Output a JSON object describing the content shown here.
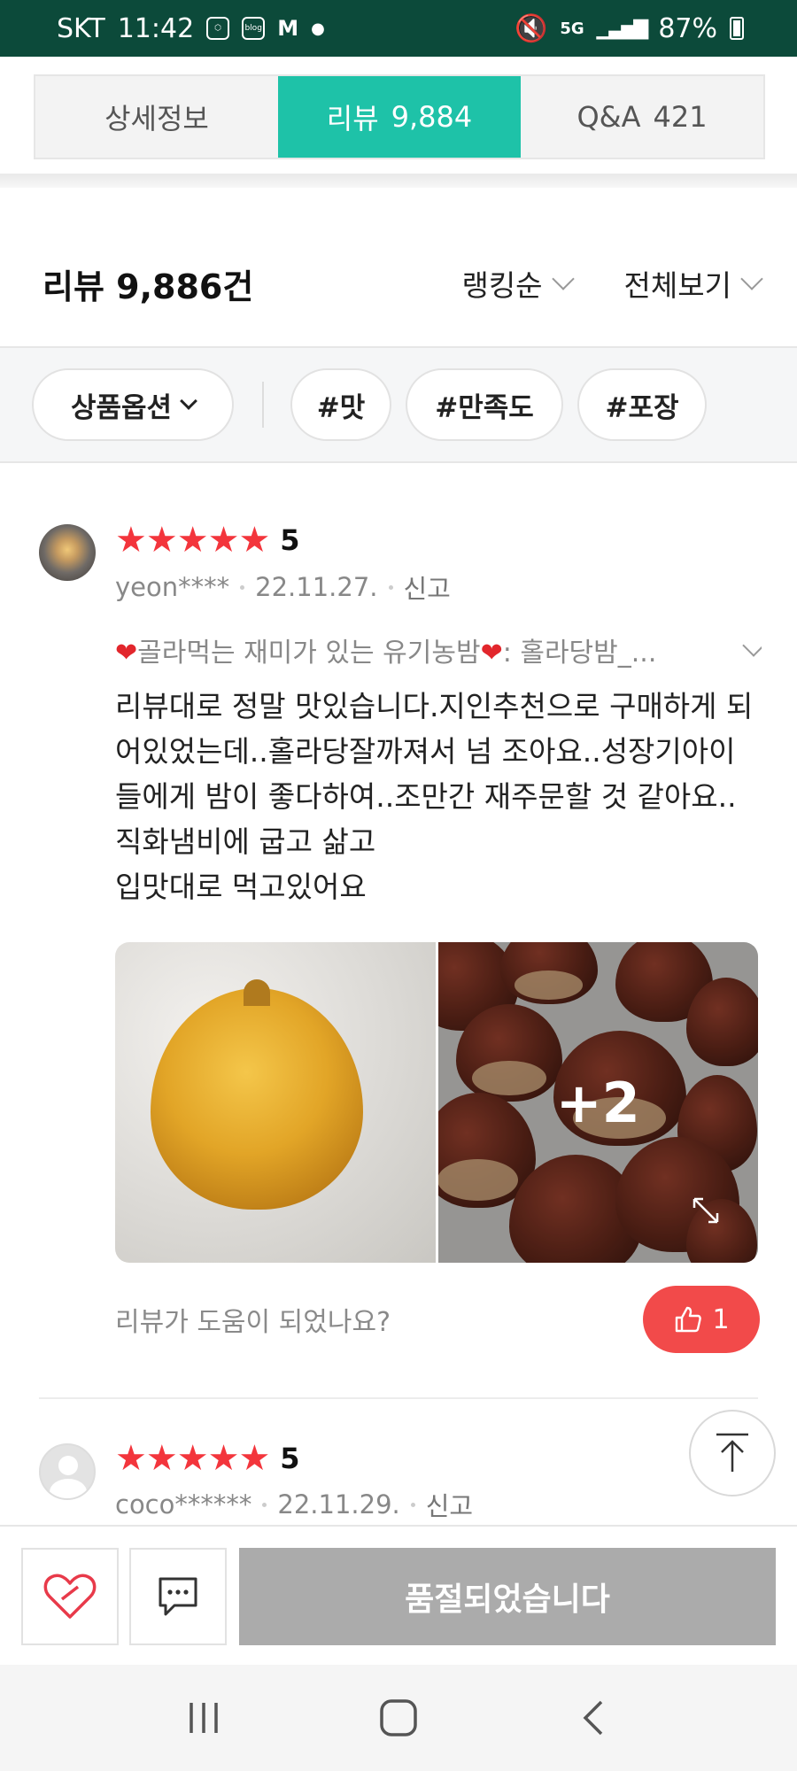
{
  "status_bar": {
    "carrier": "SKT",
    "time": "11:42",
    "blog_badge": "blog",
    "m_badge": "M",
    "network": "5G",
    "battery": "87%"
  },
  "tabs": [
    {
      "label": "상세정보",
      "count": ""
    },
    {
      "label": "리뷰",
      "count": "9,884"
    },
    {
      "label": "Q&A",
      "count": "421"
    }
  ],
  "review_header": {
    "title": "리뷰 9,886건",
    "sort_label": "랭킹순",
    "view_label": "전체보기"
  },
  "filters": {
    "option_label": "상품옵션",
    "tags": [
      "#맛",
      "#만족도",
      "#포장"
    ]
  },
  "reviews": [
    {
      "rating": 5,
      "score_label": "5",
      "user": "yeon****",
      "date": "22.11.27.",
      "report_label": "신고",
      "option_text": "골라먹는 재미가 있는 유기농밤",
      "option_suffix": ": 홀라당밤_...",
      "body": "리뷰대로 정말 맛있습니다.지인추천으로 구매하게 되어있었는데..홀라당잘까져서 넘 조아요..성장기아이들에게 밤이 좋다하여..조만간 재주문할 것 같아요..직화냄비에 굽고 삶고\n입맛대로 먹고있어요",
      "photos_more": "+2",
      "helpful_question": "리뷰가 도움이 되었나요?",
      "likes": "1"
    },
    {
      "rating": 5,
      "score_label": "5",
      "user": "coco******",
      "date": "22.11.29.",
      "report_label": "신고"
    }
  ],
  "bottom_bar": {
    "soldout_label": "품절되었습니다"
  },
  "colors": {
    "accent": "#1ec2a8",
    "star": "#f3353c",
    "like": "#f24a4a",
    "status_bar": "#0c4a3a"
  },
  "icons": [
    "heart-icon",
    "chat-icon",
    "arrow-up-icon",
    "thumbs-up-icon",
    "expand-icon",
    "recent-apps-icon",
    "home-icon",
    "back-icon"
  ]
}
